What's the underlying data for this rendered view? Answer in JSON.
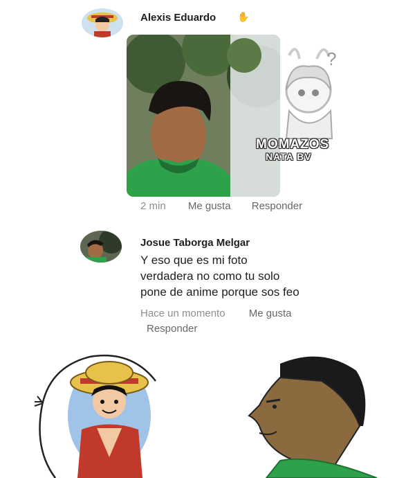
{
  "comment1": {
    "author": "Alexis Eduardo",
    "time": "2 min",
    "like": "Me gusta",
    "reply": "Responder"
  },
  "watermark": {
    "line1": "MOMAZOS",
    "line2": "NATA BV"
  },
  "comment2": {
    "author": "Josue Taborga Melgar",
    "text": "Y eso que es mi foto\nverdadera no como tu solo\npone de anime porque sos feo",
    "time": "Hace un momento",
    "like": "Me gusta",
    "reply": "Responder"
  },
  "colors": {
    "text": "#1c1e21",
    "meta": "#8a8d91",
    "shirt_green": "#2ea24a"
  }
}
